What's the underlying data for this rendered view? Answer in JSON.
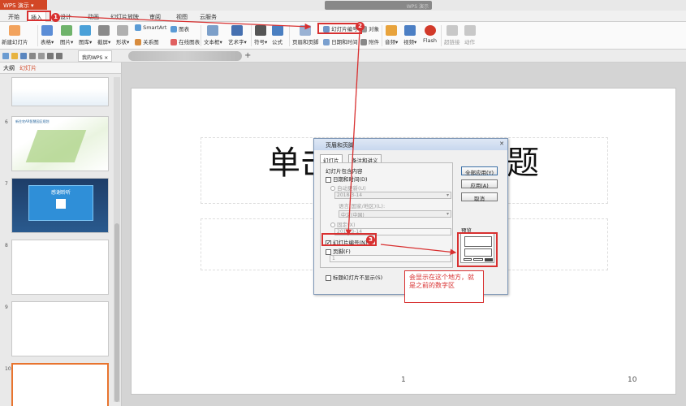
{
  "app": {
    "menu_label": "WPS 演示",
    "window_title": "WPS 演示"
  },
  "tabs": [
    "开始",
    "插入",
    "设计",
    "动画",
    "幻灯片放映",
    "审阅",
    "视图",
    "云服务"
  ],
  "ribbon": {
    "new_slide": "新建幻灯片",
    "table": "表格",
    "picture": "图片",
    "gallery": "图库",
    "screenshot": "截屏",
    "shapes": "形状",
    "smartart": "SmartArt",
    "relation": "关系图",
    "chart": "图表",
    "online_chart": "在线图表",
    "textbox": "文本框",
    "wordart": "艺术字",
    "symbol": "符号",
    "formula": "公式",
    "header_footer": "页眉和页脚",
    "slide_number": "幻灯片编号",
    "object": "对象",
    "datetime": "日期和时间",
    "attachment": "附件",
    "audio": "音频",
    "video": "视频",
    "flash": "Flash",
    "super_link": "超链接",
    "action": "动作"
  },
  "doc_tabs": {
    "wps_tab": "我的WPS"
  },
  "sidebar": {
    "tabs": [
      "大纲",
      "幻灯片"
    ],
    "thumbs": [
      {
        "num": ""
      },
      {
        "num": "6",
        "title": "新住宅AR智慧园区规划"
      },
      {
        "num": "7",
        "title": "感谢聆听"
      },
      {
        "num": "8"
      },
      {
        "num": "9"
      },
      {
        "num": "10"
      }
    ]
  },
  "slide": {
    "title_left": "单击",
    "title_right": "题",
    "page_num": "1",
    "page_total": "10"
  },
  "dialog": {
    "title": "页眉和页脚",
    "tab_slide": "幻灯片",
    "tab_notes": "备注和讲义",
    "group_label": "幻灯片包含内容",
    "datetime_label": "日期和时间(D)",
    "auto_update": "自动更新(U)",
    "auto_date": "2018-3-14",
    "language_label": "语言(国家/地区)(L):",
    "language_value": "中文(中国)",
    "fixed_label": "固定(X)",
    "fixed_date": "2018-3-14",
    "slide_number_label": "幻灯片编号(N)",
    "footer_label": "页脚(F)",
    "footer_value": "1",
    "no_title_slide": "标题幻灯片不显示(S)",
    "btn_apply_all": "全部应用(Y)",
    "btn_apply": "应用(A)",
    "btn_cancel": "取消",
    "preview_label": "预览"
  },
  "annotations": {
    "badge1": "1",
    "badge2": "2",
    "badge3": "3",
    "callout": "会显示在这个地方，就是之前的数字区"
  },
  "colors": {
    "accent": "#d24726",
    "annotation": "#d83030"
  }
}
